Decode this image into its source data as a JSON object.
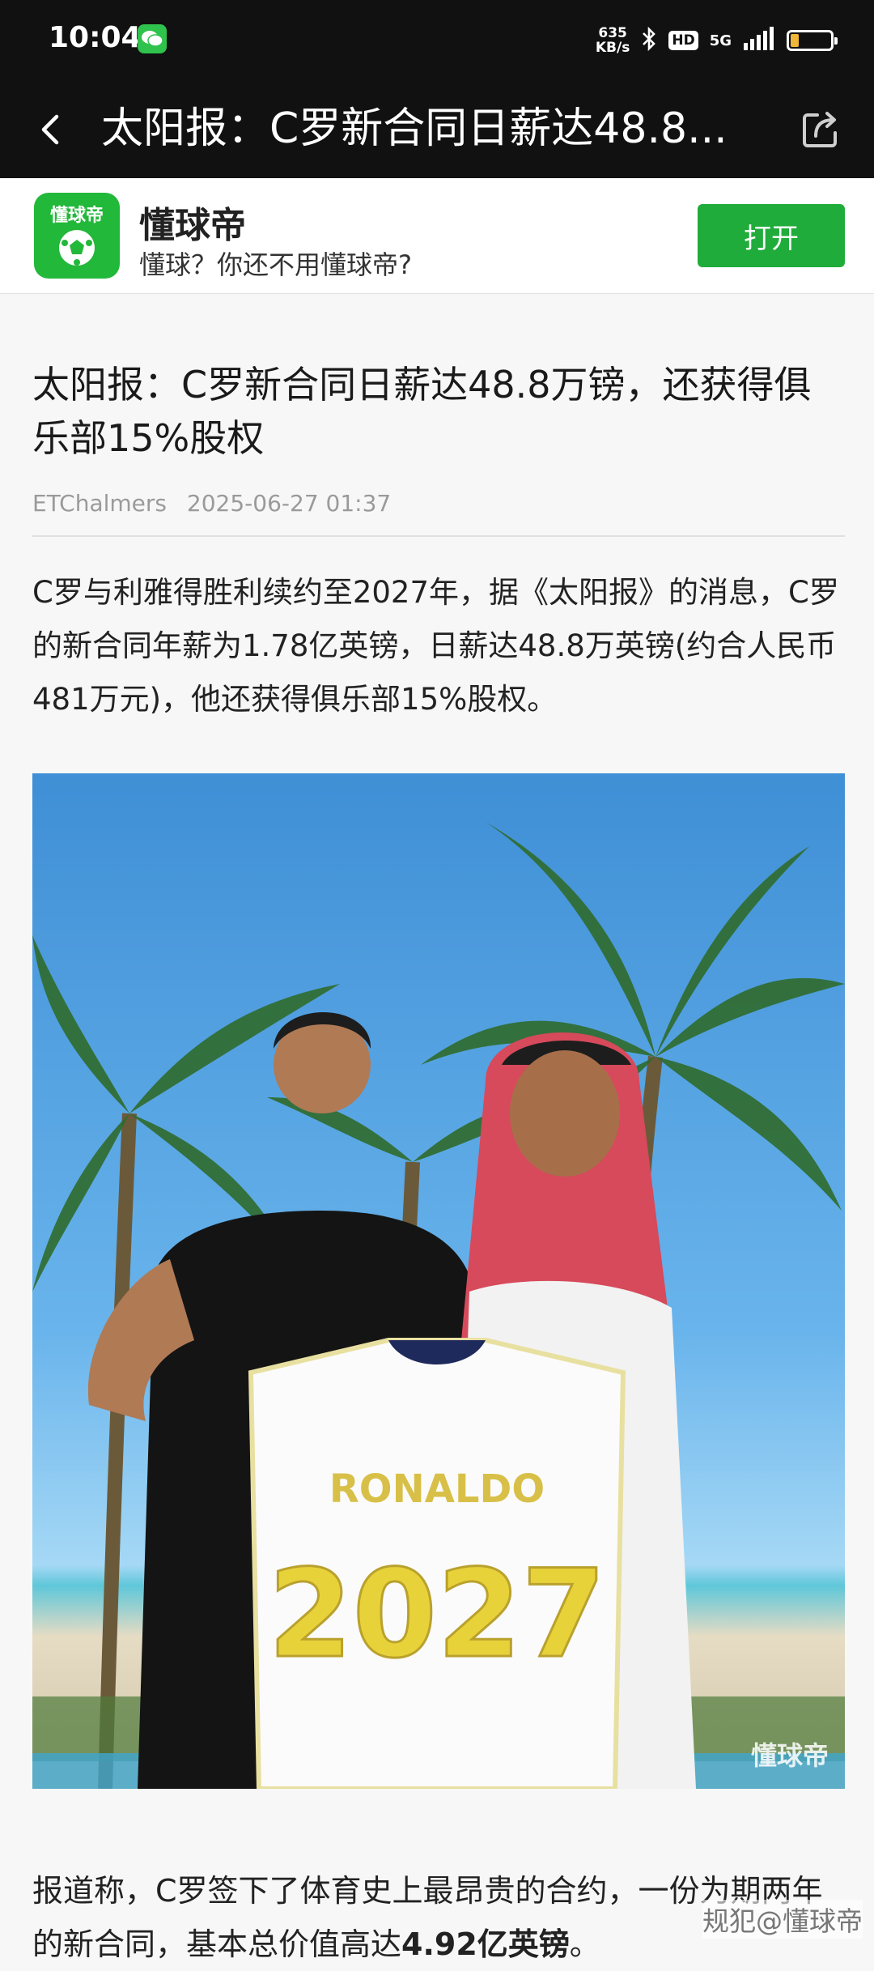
{
  "status_bar": {
    "time": "10:04",
    "net_speed_value": "635",
    "net_speed_unit": "KB/s",
    "hd": "HD",
    "signal": "5G",
    "battery": "19",
    "battery_level": 0.19
  },
  "title_bar": {
    "title": "太阳报：C罗新合同日薪达48.8...",
    "back_icon": "back-arrow-icon",
    "share_icon": "share-icon"
  },
  "app_banner": {
    "logo_text": "懂球帝",
    "name": "懂球帝",
    "slogan": "懂球？你还不用懂球帝?",
    "open_label": "打开"
  },
  "article": {
    "title": "太阳报：C罗新合同日薪达48.8万镑，还获得俱乐部15%股权",
    "author": "ETChalmers",
    "date": "2025-06-27 01:37",
    "paragraph1": "C罗与利雅得胜利续约至2027年，据《太阳报》的消息，C罗的新合同年薪为1.78亿英镑，日薪达48.8万英镑(约合人民币481万元)，他还获得俱乐部15%股权。",
    "photo": {
      "jersey_name": "RONALDO",
      "jersey_number": "2027",
      "watermark": "懂球帝"
    },
    "paragraph2_start": "报道称，C罗签下了体育史上最昂贵的合约，一份为期两年的新合同，基本总价值高达",
    "paragraph2_bold": "4.92亿英镑",
    "paragraph2_end": "。"
  },
  "overlay_watermark": "规犯@懂球帝"
}
